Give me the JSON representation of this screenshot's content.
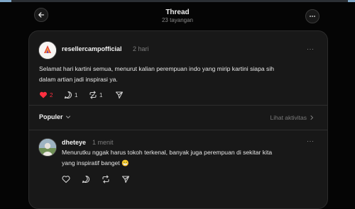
{
  "header": {
    "title": "Thread",
    "views": "23 tayangan"
  },
  "post": {
    "username": "resellercampofficial",
    "time": "2 hari",
    "text_line1": "Selamat hari kartini semua, menurut kalian perempuan indo yang mirip kartini siapa sih",
    "text_line2": "dalam artian jadi inspirasi ya.",
    "like_count": "2",
    "comment_count": "1",
    "repost_count": "1",
    "menu_label": "···"
  },
  "sort": {
    "label": "Populer",
    "activity_label": "Lihat aktivitas"
  },
  "reply": {
    "username": "dheteye",
    "time": "1 menit",
    "text_line1": "Menurutku nggak harus tokoh terkenal, banyak juga perempuan di sekitar kita",
    "text_line2": "yang inspiratif banget 😁",
    "menu_label": "···"
  },
  "colors": {
    "like_red": "#ff3040",
    "background": "#050505",
    "card": "#181818"
  }
}
